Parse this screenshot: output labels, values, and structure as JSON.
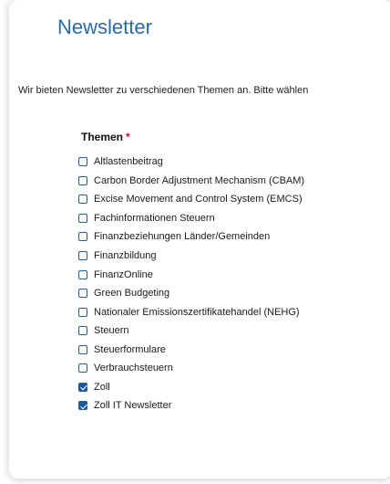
{
  "page": {
    "title": "Newsletter",
    "intro": "Wir bieten Newsletter zu verschiedenen Themen an. Bitte wählen"
  },
  "topics": {
    "legend": "Themen",
    "required_mark": "*",
    "items": [
      {
        "label": "Altlastenbeitrag",
        "checked": false
      },
      {
        "label": "Carbon Border Adjustment Mechanism (CBAM)",
        "checked": false
      },
      {
        "label": "Excise Movement and Control System (EMCS)",
        "checked": false
      },
      {
        "label": "Fachinformationen Steuern",
        "checked": false
      },
      {
        "label": "Finanzbeziehungen Länder/Gemeinden",
        "checked": false
      },
      {
        "label": "Finanzbildung",
        "checked": false
      },
      {
        "label": "FinanzOnline",
        "checked": false
      },
      {
        "label": "Green Budgeting",
        "checked": false
      },
      {
        "label": "Nationaler Emissionszertifikatehandel (NEHG)",
        "checked": false
      },
      {
        "label": "Steuern",
        "checked": false
      },
      {
        "label": "Steuerformulare",
        "checked": false
      },
      {
        "label": "Verbrauchsteuern",
        "checked": false
      },
      {
        "label": "Zoll",
        "checked": true
      },
      {
        "label": "Zoll IT Newsletter",
        "checked": true
      }
    ]
  },
  "colors": {
    "title": "#2a6aa8",
    "checkbox": "#1f5b98",
    "required": "#d1002f"
  }
}
